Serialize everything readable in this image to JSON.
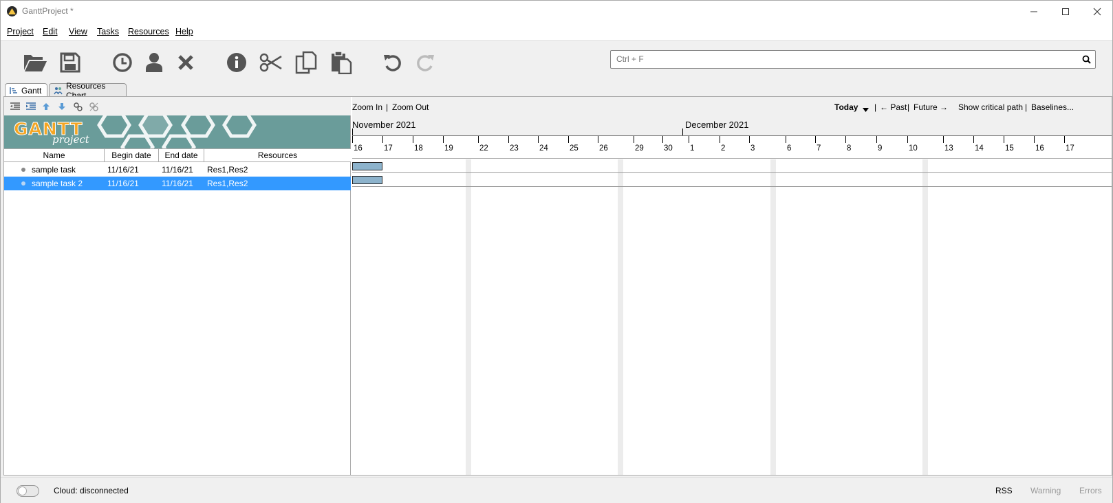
{
  "window": {
    "title": "GanttProject *"
  },
  "menu": [
    "Project",
    "Edit",
    "View",
    "Tasks",
    "Resources",
    "Help"
  ],
  "search": {
    "placeholder": "Ctrl + F"
  },
  "tabs": [
    "Gantt",
    "Resources Chart"
  ],
  "table": {
    "headers": [
      "Name",
      "Begin date",
      "End date",
      "Resources"
    ],
    "rows": [
      {
        "name": "sample task",
        "begin": "11/16/21",
        "end": "11/16/21",
        "resources": "Res1,Res2"
      },
      {
        "name": "sample task 2",
        "begin": "11/16/21",
        "end": "11/16/21",
        "resources": "Res1,Res2"
      }
    ]
  },
  "banner": {
    "logo_main": "GANTT",
    "logo_sub": "project"
  },
  "chart_toolbar": {
    "zoom_in": "Zoom In",
    "sep1": "|",
    "zoom_out": "Zoom Out",
    "today": "Today",
    "sep2": "|",
    "past": "← Past",
    "sep3": "|",
    "future": "Future →",
    "critical_path": "Show critical path",
    "sep4": "|",
    "baselines": "Baselines..."
  },
  "timeline": {
    "months": [
      "November 2021",
      "December 2021"
    ],
    "days": [
      "16",
      "17",
      "18",
      "19",
      "22",
      "23",
      "24",
      "25",
      "26",
      "29",
      "30",
      "1",
      "2",
      "3",
      "6",
      "7",
      "8",
      "9",
      "10",
      "13",
      "14",
      "15",
      "16",
      "17"
    ]
  },
  "status": {
    "cloud": "Cloud: disconnected",
    "rss": "RSS",
    "warning": "Warning",
    "errors": "Errors"
  },
  "colors": {
    "selection": "#3399ff",
    "bar": "#8db3cc",
    "banner": "#6a9c9a",
    "icon": "#555555"
  }
}
